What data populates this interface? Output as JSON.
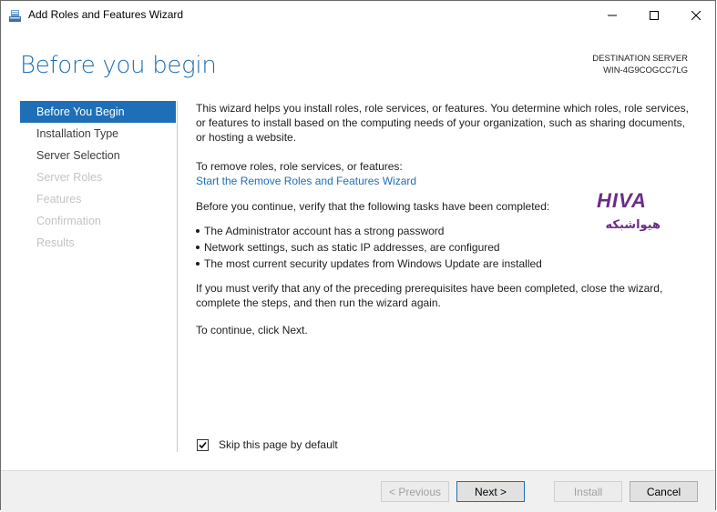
{
  "window": {
    "title": "Add Roles and Features Wizard",
    "controls": {
      "minimize": "minimize-icon",
      "maximize": "maximize-icon",
      "close": "close-icon"
    }
  },
  "header": {
    "page_title": "Before you begin",
    "destination_label": "DESTINATION SERVER",
    "destination_server": "WIN-4G9COGCC7LG"
  },
  "nav": {
    "items": [
      {
        "label": "Before You Begin",
        "state": "active"
      },
      {
        "label": "Installation Type",
        "state": "enabled"
      },
      {
        "label": "Server Selection",
        "state": "enabled"
      },
      {
        "label": "Server Roles",
        "state": "disabled"
      },
      {
        "label": "Features",
        "state": "disabled"
      },
      {
        "label": "Confirmation",
        "state": "disabled"
      },
      {
        "label": "Results",
        "state": "disabled"
      }
    ]
  },
  "content": {
    "intro": "This wizard helps you install roles, role services, or features. You determine which roles, role services, or features to install based on the computing needs of your organization, such as sharing documents, or hosting a website.",
    "remove_label": "To remove roles, role services, or features:",
    "remove_link": "Start the Remove Roles and Features Wizard",
    "verify_label": "Before you continue, verify that the following tasks have been completed:",
    "tasks": [
      "The Administrator account has a strong password",
      "Network settings, such as static IP addresses, are configured",
      "The most current security updates from Windows Update are installed"
    ],
    "prereq_note": "If you must verify that any of the preceding prerequisites have been completed, close the wizard, complete the steps, and then run the wizard again.",
    "continue_note": "To continue, click Next."
  },
  "skip_checkbox": {
    "label": "Skip this page by default",
    "checked": true
  },
  "footer": {
    "previous": "< Previous",
    "next": "Next >",
    "install": "Install",
    "cancel": "Cancel"
  },
  "watermark": {
    "latin": "HIVA",
    "arabic": "هیواشبکه"
  },
  "colors": {
    "accent": "#1e6fb7",
    "title": "#1f6fb3",
    "watermark": "#6b2d8a"
  }
}
